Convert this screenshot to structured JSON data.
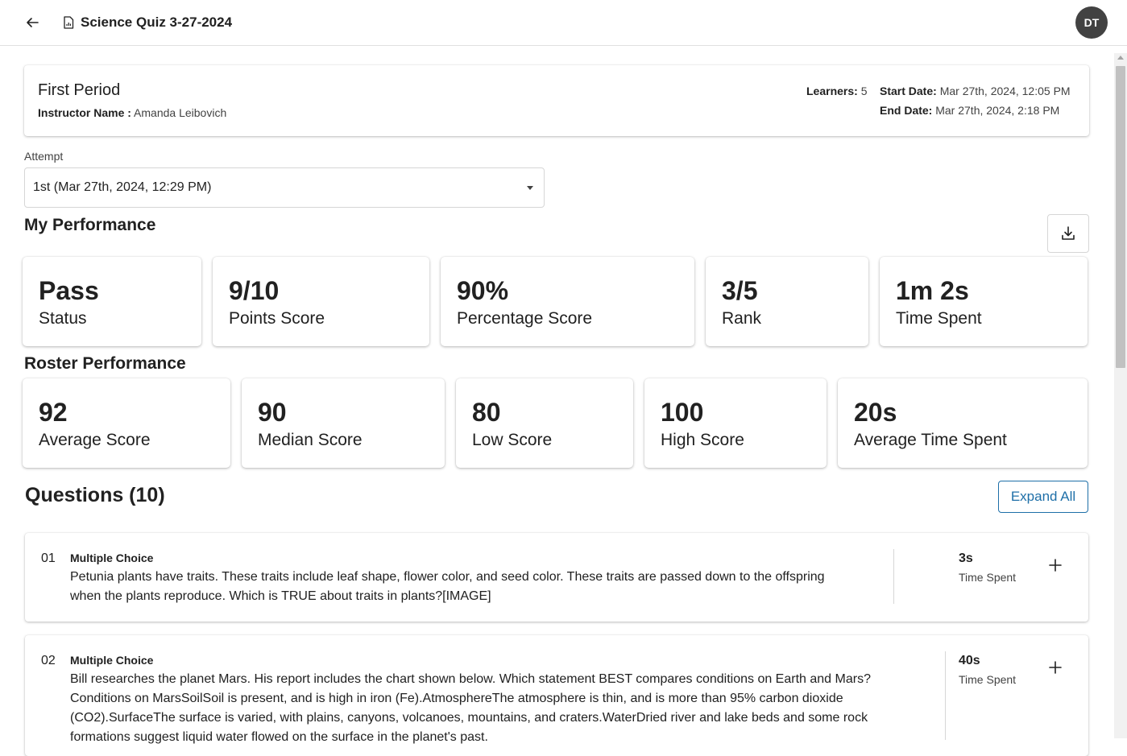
{
  "header": {
    "title": "Science Quiz 3-27-2024",
    "avatar_initials": "DT"
  },
  "period": {
    "name": "First Period",
    "instructor_label": "Instructor Name :",
    "instructor_value": "Amanda Leibovich",
    "learners_label": "Learners:",
    "learners_value": "5",
    "start_label": "Start Date:",
    "start_value": "Mar 27th, 2024, 12:05 PM",
    "end_label": "End Date:",
    "end_value": "Mar 27th, 2024, 2:18 PM"
  },
  "attempt": {
    "label": "Attempt",
    "selected": "1st (Mar 27th, 2024, 12:29 PM)"
  },
  "my_performance": {
    "title": "My Performance",
    "cards": [
      {
        "value": "Pass",
        "label": "Status"
      },
      {
        "value": "9/10",
        "label": "Points Score"
      },
      {
        "value": "90%",
        "label": "Percentage Score"
      },
      {
        "value": "3/5",
        "label": "Rank"
      },
      {
        "value": "1m 2s",
        "label": "Time Spent"
      }
    ]
  },
  "roster_performance": {
    "title": "Roster Performance",
    "cards": [
      {
        "value": "92",
        "label": "Average Score"
      },
      {
        "value": "90",
        "label": "Median Score"
      },
      {
        "value": "80",
        "label": "Low Score"
      },
      {
        "value": "100",
        "label": "High Score"
      },
      {
        "value": "20s",
        "label": "Average Time Spent"
      }
    ]
  },
  "questions": {
    "title": "Questions (10)",
    "expand_label": "Expand All",
    "items": [
      {
        "number": "01",
        "type": "Multiple Choice",
        "text_lines": [
          "Petunia plants have traits. These traits include leaf shape, flower color, and seed color. These traits are passed down to the offspring",
          "when the plants reproduce. Which is TRUE about traits in plants?[IMAGE]"
        ],
        "time": "3s",
        "time_label": "Time Spent"
      },
      {
        "number": "02",
        "type": "Multiple Choice",
        "text_lines": [
          "Bill researches the planet Mars. His report includes the chart shown below. Which statement BEST compares conditions on Earth and Mars?",
          "Conditions on MarsSoilSoil is present, and is high in iron (Fe).AtmosphereThe atmosphere is thin, and is more than 95% carbon dioxide",
          "(CO2).SurfaceThe surface is varied, with plains, canyons, volcanoes, mountains, and craters.WaterDried river and lake beds and some rock",
          "formations suggest liquid water flowed on the surface in the planet's past."
        ],
        "time": "40s",
        "time_label": "Time Spent"
      }
    ]
  }
}
